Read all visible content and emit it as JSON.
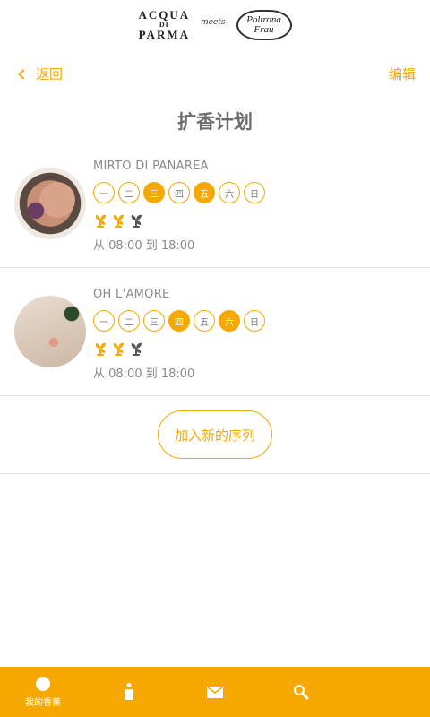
{
  "brand": {
    "aqua_line1": "ACQUA",
    "aqua_line2": "DI",
    "aqua_line3": "PARMA",
    "meets": "meets",
    "pf_line1": "Poltrona",
    "pf_line2": "Frau"
  },
  "nav": {
    "back_label": "返回",
    "edit_label": "编辑"
  },
  "page_title": "扩香计划",
  "colors": {
    "accent": "#f5a900",
    "text": "#8a8a8a",
    "divider": "#e3e3e3"
  },
  "schedules": [
    {
      "name": "MIRTO DI PANAREA",
      "days": [
        {
          "label": "一",
          "active": false
        },
        {
          "label": "二",
          "active": false
        },
        {
          "label": "三",
          "active": true
        },
        {
          "label": "四",
          "active": false
        },
        {
          "label": "五",
          "active": true
        },
        {
          "label": "六",
          "active": false
        },
        {
          "label": "日",
          "active": false
        }
      ],
      "fan_level": 2,
      "fan_max": 3,
      "time": "从 08:00 到 18:00"
    },
    {
      "name": "OH L'AMORE",
      "days": [
        {
          "label": "一",
          "active": false
        },
        {
          "label": "二",
          "active": false
        },
        {
          "label": "三",
          "active": false
        },
        {
          "label": "四",
          "active": true
        },
        {
          "label": "五",
          "active": false
        },
        {
          "label": "六",
          "active": true
        },
        {
          "label": "日",
          "active": false
        }
      ],
      "fan_level": 2,
      "fan_max": 3,
      "time": "从 08:00 到 18:00"
    }
  ],
  "add_button_label": "加入新的序列",
  "tabbar": {
    "tabs": [
      {
        "icon": "drop-icon",
        "label": "我的香薰"
      },
      {
        "icon": "bottle-icon",
        "label": ""
      },
      {
        "icon": "mail-icon",
        "label": ""
      },
      {
        "icon": "search-icon",
        "label": ""
      }
    ]
  }
}
